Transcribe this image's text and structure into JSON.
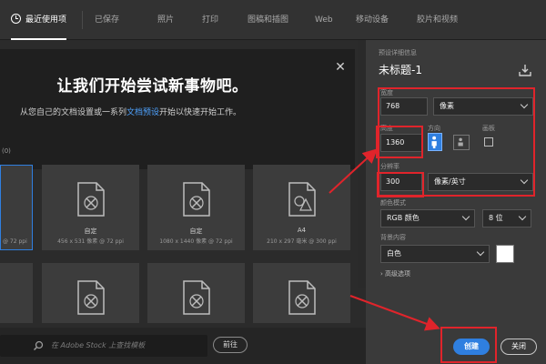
{
  "tabs": [
    {
      "label": "最近使用项",
      "active": true
    },
    {
      "label": "已保存"
    },
    {
      "label": "照片"
    },
    {
      "label": "打印"
    },
    {
      "label": "图稿和插图"
    },
    {
      "label": "Web"
    },
    {
      "label": "移动设备"
    },
    {
      "label": "胶片和视频"
    }
  ],
  "banner": {
    "title": "让我们开始尝试新事物吧。",
    "subtitle_before": "从您自己的文档设置或一系列",
    "subtitle_link": "文档预设",
    "subtitle_after": "开始以快速开始工作。"
  },
  "recent": {
    "count_label": "(0)"
  },
  "cards": [
    {
      "name": "",
      "size": "@ 72 ppi",
      "selected": true
    },
    {
      "name": "自定",
      "size": "456 x 531 像素 @ 72 ppi"
    },
    {
      "name": "自定",
      "size": "1080 x 1440 像素 @ 72 ppi"
    },
    {
      "name": "A4",
      "size": "210 x 297 毫米 @ 300 ppi"
    }
  ],
  "search": {
    "placeholder": "在 Adobe Stock 上查找模板",
    "go_label": "前往"
  },
  "details": {
    "section_label": "预设详细信息",
    "doc_title": "未标题-1",
    "width_label": "宽度",
    "width_value": "768",
    "width_unit": "像素",
    "height_label": "高度",
    "height_value": "1360",
    "orientation_label": "方向",
    "artboard_label": "画板",
    "resolution_label": "分辨率",
    "resolution_value": "300",
    "resolution_unit": "像素/英寸",
    "color_mode_label": "颜色模式",
    "color_mode_value": "RGB 颜色",
    "bit_depth_value": "8 位",
    "background_label": "背景内容",
    "background_value": "白色",
    "advanced_label": "高级选项",
    "create_label": "创建",
    "close_label": "关闭"
  },
  "colors": {
    "accent": "#2f7fe0",
    "annotation": "#e0242b"
  }
}
